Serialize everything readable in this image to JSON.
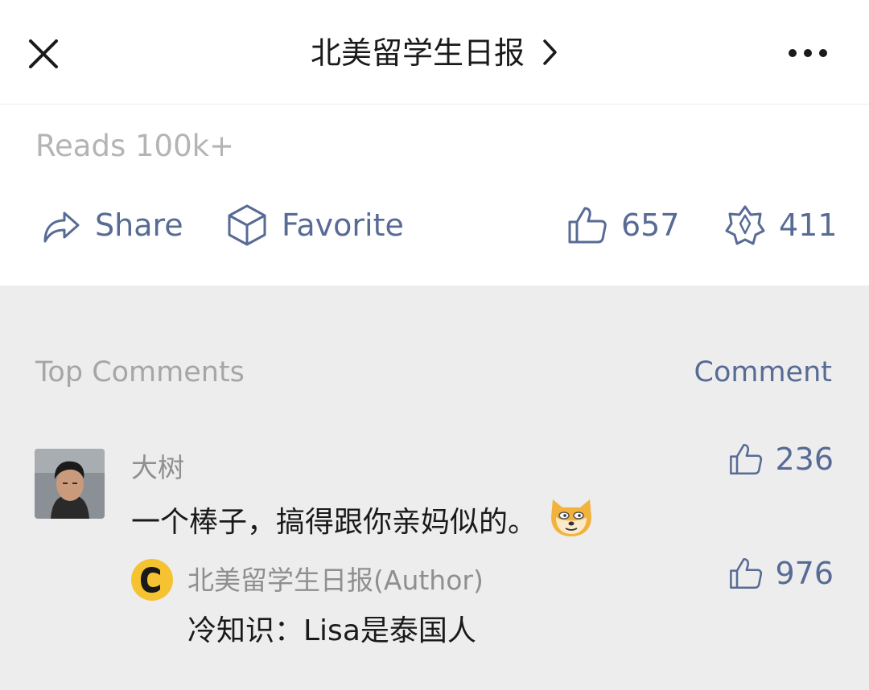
{
  "header": {
    "account_name": "北美留学生日报",
    "close_icon": "close-icon",
    "more_icon": "more-dots-icon"
  },
  "article_footer": {
    "reads": "Reads 100k+",
    "share_label": "Share",
    "favorite_label": "Favorite",
    "like_count": "657",
    "wow_count": "411"
  },
  "comments": {
    "section_title": "Top Comments",
    "write_label": "Comment",
    "items": [
      {
        "author": "大树",
        "text": "一个棒子，搞得跟你亲妈似的。",
        "emoji": "doge-emoji",
        "likes": "236",
        "reply": {
          "author": "北美留学生日报(Author)",
          "text": "冷知识：Lisa是泰国人",
          "likes": "976"
        }
      }
    ]
  },
  "colors": {
    "link_blue": "#576b95",
    "muted_gray": "#b4b4b4",
    "comment_bg": "#ededed",
    "author_badge": "#f5c231"
  }
}
